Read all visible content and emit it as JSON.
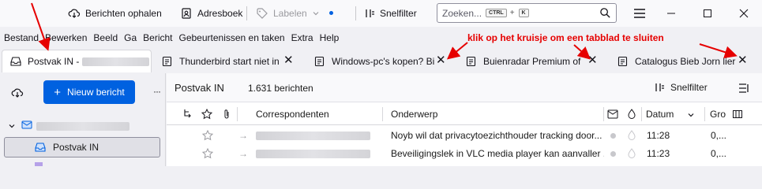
{
  "toolbar": {
    "get_messages": "Berichten ophalen",
    "address_book": "Adresboek",
    "tags": "Labelen",
    "quick_filter": "Snelfilter",
    "search_placeholder": "Zoeken...",
    "search_key1": "CTRL",
    "search_plus": "+",
    "search_key2": "K"
  },
  "menu": [
    "Bestand",
    "Bewerken",
    "Beeld",
    "Ga",
    "Bericht",
    "Gebeurtenissen en taken",
    "Extra",
    "Help"
  ],
  "tabs": [
    {
      "label": "Postvak IN -"
    },
    {
      "label": "Thunderbird start niet in"
    },
    {
      "label": "Windows-pc's kopen? Bi"
    },
    {
      "label": "Buienradar Premium of"
    },
    {
      "label": "Catalogus Bieb Jorn lier"
    }
  ],
  "annotation": "klik op het kruisje om een tabblad te sluiten",
  "folder_pane": {
    "new_message": "Nieuw bericht",
    "more": "···",
    "inbox": "Postvak IN"
  },
  "list": {
    "folder_title": "Postvak IN",
    "message_count": "1.631 berichten",
    "quick_filter": "Snelfilter",
    "columns": {
      "correspondents": "Correspondenten",
      "subject": "Onderwerp",
      "date": "Datum",
      "size": "Gro"
    },
    "rows": [
      {
        "subject": "Noyb wil dat privacytoezichthouder tracking door...",
        "date": "11:28",
        "size": "0,..."
      },
      {
        "subject": "Beveiligingslek in VLC media player kan aanvaller ...",
        "date": "11:23",
        "size": "0,..."
      }
    ]
  },
  "colors": {
    "accent": "#0061e0",
    "annotation": "#e60000"
  }
}
